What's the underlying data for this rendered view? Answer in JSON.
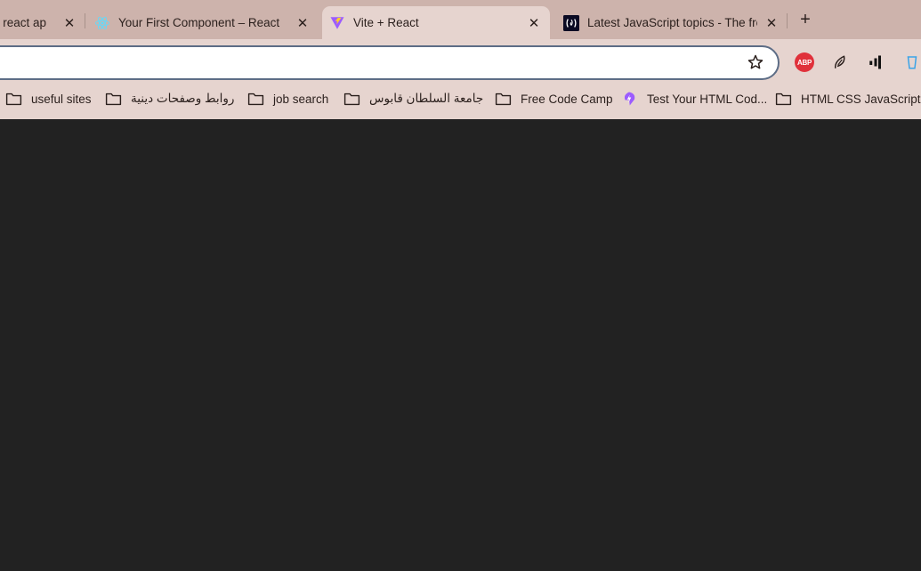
{
  "tabs": [
    {
      "title": "g react ap",
      "active": false
    },
    {
      "title": "Your First Component – React",
      "active": false
    },
    {
      "title": "Vite + React",
      "active": true
    },
    {
      "title": "Latest JavaScript topics - The fre",
      "active": false
    }
  ],
  "tab_close_glyph": "✕",
  "newtab_glyph": "+",
  "omnibox": {
    "value": ""
  },
  "bookmarks": [
    {
      "label": "useful sites",
      "icon": "folder-icon"
    },
    {
      "label": "روابط وصفحات دينية",
      "icon": "folder-icon"
    },
    {
      "label": "job search",
      "icon": "folder-icon"
    },
    {
      "label": "جامعة السلطان قابوس",
      "icon": "folder-icon"
    },
    {
      "label": "Free Code Camp",
      "icon": "folder-icon"
    },
    {
      "label": "Test Your HTML Cod...",
      "icon": "bolt-favicon-icon"
    },
    {
      "label": "HTML CSS JavaScript",
      "icon": "folder-icon"
    }
  ],
  "extensions": {
    "abp_label": "ABP"
  },
  "colors": {
    "tabstrip": "#cdb3ac",
    "toolbar": "#e6d4cf",
    "omnibox_border": "#5d6d86",
    "page_background": "#222222",
    "abp_red": "#e0313b",
    "vite_purple": "#9c5cff",
    "react_blue": "#61dafb"
  }
}
